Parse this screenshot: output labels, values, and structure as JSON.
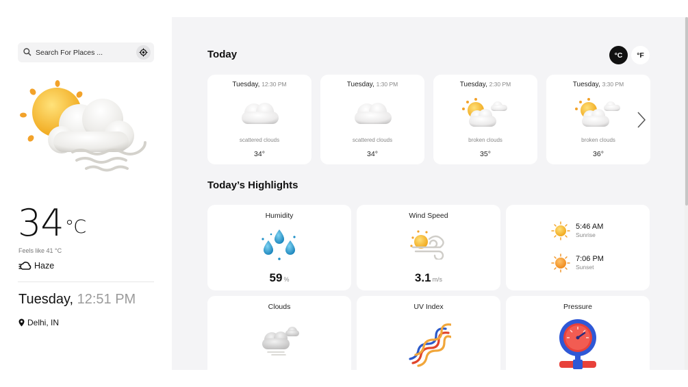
{
  "search": {
    "placeholder": "Search For Places ...",
    "value": ""
  },
  "current": {
    "temperature": "34",
    "unit": "°C",
    "feels_like": "Feels like 41 °C",
    "condition": "Haze",
    "day": "Tuesday,",
    "time": "12:51 PM",
    "location": "Delhi, IN"
  },
  "today": {
    "title": "Today",
    "unit_c": "°C",
    "unit_f": "°F",
    "hourly": [
      {
        "day": "Tuesday,",
        "time": "12:30 PM",
        "desc": "scattered clouds",
        "temp": "34°",
        "icon": "scattered-clouds-icon"
      },
      {
        "day": "Tuesday,",
        "time": "1:30 PM",
        "desc": "scattered clouds",
        "temp": "34°",
        "icon": "scattered-clouds-icon"
      },
      {
        "day": "Tuesday,",
        "time": "2:30 PM",
        "desc": "broken clouds",
        "temp": "35°",
        "icon": "broken-clouds-icon"
      },
      {
        "day": "Tuesday,",
        "time": "3:30 PM",
        "desc": "broken clouds",
        "temp": "36°",
        "icon": "broken-clouds-icon"
      }
    ]
  },
  "highlights": {
    "title": "Today’s Highlights",
    "humidity": {
      "label": "Humidity",
      "value": "59",
      "unit": "%"
    },
    "wind": {
      "label": "Wind Speed",
      "value": "3.1",
      "unit": "m/s"
    },
    "sunrise": {
      "time": "5:46 AM",
      "label": "Sunrise"
    },
    "sunset": {
      "time": "7:06 PM",
      "label": "Sunset"
    },
    "clouds": {
      "label": "Clouds"
    },
    "uv": {
      "label": "UV Index"
    },
    "pressure": {
      "label": "Pressure"
    }
  },
  "colors": {
    "accent": "#111111",
    "panel": "#f4f4f6",
    "card": "#ffffff",
    "sun": "#f2b52a",
    "water": "#1fa1d6"
  }
}
